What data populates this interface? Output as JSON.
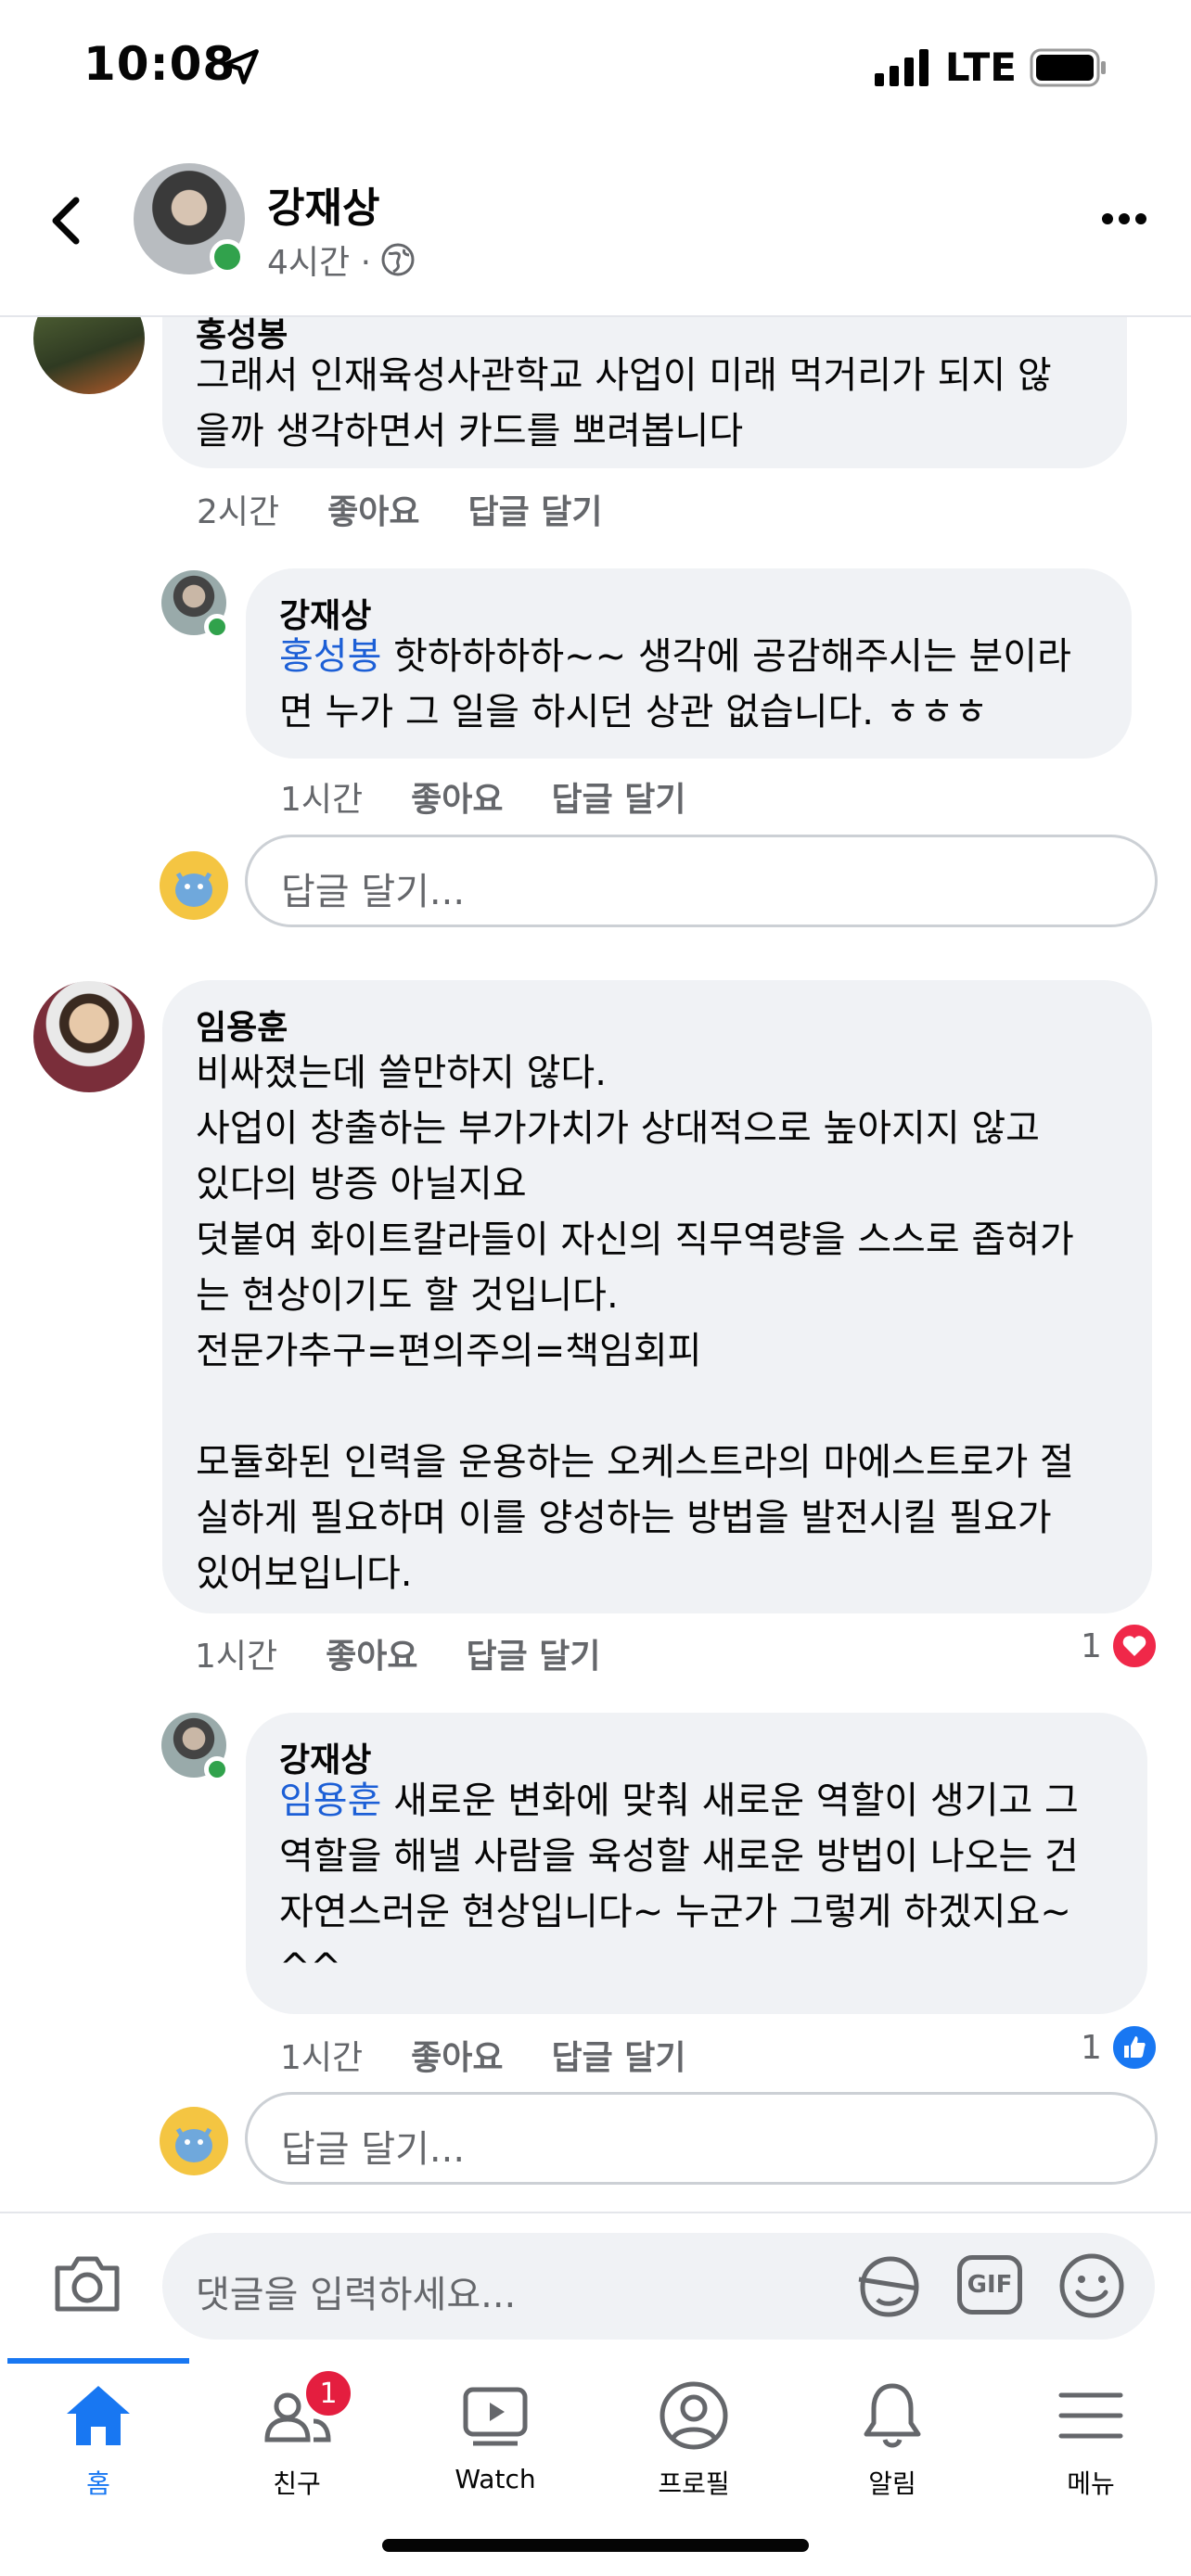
{
  "status": {
    "time": "10:08",
    "network": "LTE"
  },
  "header": {
    "author": "강재상",
    "time": "4시간 ·"
  },
  "comments": [
    {
      "author": "홍성봉",
      "text": "그래서 인재육성사관학교 사업이 미래 먹거리가 되지 않\n을까 생각하면서 카드를 뽀려봅니다",
      "time": "2시간",
      "like": "좋아요",
      "reply": "답글 달기"
    },
    {
      "author": "강재상",
      "mention": "홍성봉",
      "text": " 핫하하하하~~ 생각에 공감해주시는 분이라\n면 누가 그 일을 하시던 상관 없습니다. ㅎㅎㅎ",
      "time": "1시간",
      "like": "좋아요",
      "reply": "답글 달기"
    },
    {
      "author": "임용훈",
      "text": "비싸졌는데 쓸만하지 않다.\n사업이 창출하는 부가가치가 상대적으로 높아지지 않고\n있다의 방증 아닐지요\n덧붙여 화이트칼라들이 자신의 직무역량을 스스로 좁혀가\n는 현상이기도 할 것입니다.\n전문가추구=편의주의=책임회피\n\n모듈화된 인력을 운용하는 오케스트라의 마에스트로가 절\n실하게 필요하며 이를 양성하는 방법을 발전시킬 필요가\n있어보입니다.",
      "time": "1시간",
      "like": "좋아요",
      "reply": "답글 달기",
      "reactions": "1"
    },
    {
      "author": "강재상",
      "mention": "임용훈",
      "text": " 새로운 변화에 맞춰 새로운 역할이 생기고 그\n역할을 해낼 사람을 육성할 새로운 방법이 나오는 건\n자연스러운 현상입니다~ 누군가 그렇게 하겠지요~\n^^",
      "time": "1시간",
      "like": "좋아요",
      "reply": "답글 달기",
      "reactions": "1"
    }
  ],
  "reply_placeholder": "답글 달기...",
  "composer": {
    "placeholder": "댓글을 입력하세요...",
    "gif": "GIF"
  },
  "tabs": [
    {
      "label": "홈",
      "icon": "home-icon",
      "active": true
    },
    {
      "label": "친구",
      "icon": "friends-icon",
      "badge": "1"
    },
    {
      "label": "Watch",
      "icon": "watch-icon"
    },
    {
      "label": "프로필",
      "icon": "profile-icon"
    },
    {
      "label": "알림",
      "icon": "bell-icon"
    },
    {
      "label": "메뉴",
      "icon": "menu-icon"
    }
  ],
  "colors": {
    "accent": "#1877f2",
    "mention": "#1c5fd6",
    "bubble": "#f0f2f5",
    "online": "#31a24c",
    "love": "#f02849"
  }
}
